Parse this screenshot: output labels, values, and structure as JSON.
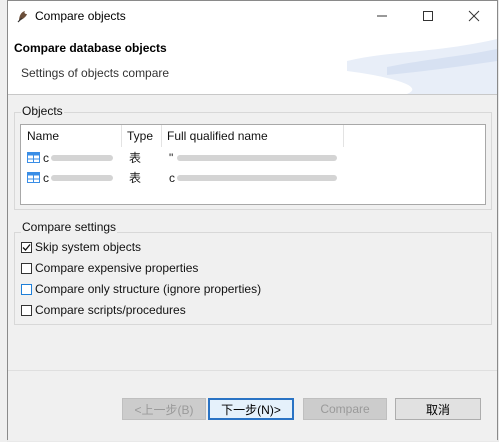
{
  "window": {
    "title": "Compare objects",
    "controls": {
      "minimize": "–",
      "maximize": "☐",
      "close": "✕"
    }
  },
  "header": {
    "title": "Compare database objects",
    "subtitle": "Settings of objects compare"
  },
  "objects": {
    "group_label": "Objects",
    "columns": [
      "Name",
      "Type",
      "Full qualified name"
    ],
    "rows": [
      {
        "icon": "table-icon",
        "name": "c",
        "type": "表",
        "fqn": "\""
      },
      {
        "icon": "table-icon",
        "name": "c",
        "type": "表",
        "fqn": "c"
      }
    ]
  },
  "settings": {
    "group_label": "Compare settings",
    "options": [
      {
        "label": "Skip system objects",
        "checked": true
      },
      {
        "label": "Compare expensive properties",
        "checked": false
      },
      {
        "label": "Compare only structure (ignore properties)",
        "checked": false
      },
      {
        "label": "Compare scripts/procedures",
        "checked": false
      }
    ]
  },
  "footer": {
    "back_label": "<上一步(B)",
    "next_label": "下一步(N)>",
    "compare_label": "Compare",
    "cancel_label": "取消"
  },
  "colors": {
    "accent": "#2a73c4",
    "table_icon": "#3a8ee6",
    "focus": "#1e7fd8"
  }
}
